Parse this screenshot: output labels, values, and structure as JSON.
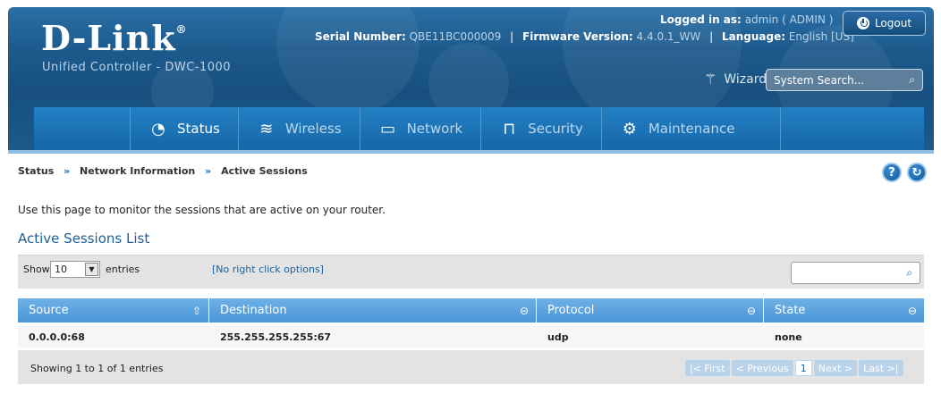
{
  "brand": {
    "logo": "D-Link",
    "reg": "®",
    "subtitle": "Unified Controller - DWC-1000"
  },
  "device": {
    "serial_label": "Serial Number:",
    "serial_value": "QBE11BC000009",
    "firmware_label": "Firmware Version:",
    "firmware_value": "4.4.0.1_WW",
    "language_label": "Language:",
    "language_value": "English [US]"
  },
  "session": {
    "logged_label": "Logged in as:",
    "logged_value": "admin ( ADMIN )",
    "logout": "Logout"
  },
  "tools": {
    "wizard": "Wizard",
    "search_placeholder": "System Search..."
  },
  "nav": {
    "status": "Status",
    "wireless": "Wireless",
    "network": "Network",
    "security": "Security",
    "maintenance": "Maintenance"
  },
  "breadcrumb": {
    "item1": "Status",
    "item2": "Network Information",
    "item3": "Active Sessions",
    "sep": "»"
  },
  "page": {
    "help": "?",
    "description": "Use this page to monitor the sessions that are active on your router.",
    "section_title": "Active Sessions List"
  },
  "table": {
    "show_label": "Show",
    "show_value": "10",
    "entries_label": "entries",
    "context_note": "[No right click options]",
    "columns": {
      "source": "Source",
      "destination": "Destination",
      "protocol": "Protocol",
      "state": "State"
    },
    "rows": [
      {
        "source": "0.0.0.0:68",
        "destination": "255.255.255.255:67",
        "protocol": "udp",
        "state": "none"
      }
    ],
    "info": "Showing 1 to 1 of 1 entries",
    "pager": {
      "first": "First",
      "previous": "Previous",
      "page": "1",
      "next": "Next",
      "last": "Last"
    }
  },
  "colors": {
    "header": "#1d5a8c",
    "nav": "#1567a8",
    "table_header": "#4a96d6",
    "link": "#1d5f99"
  }
}
